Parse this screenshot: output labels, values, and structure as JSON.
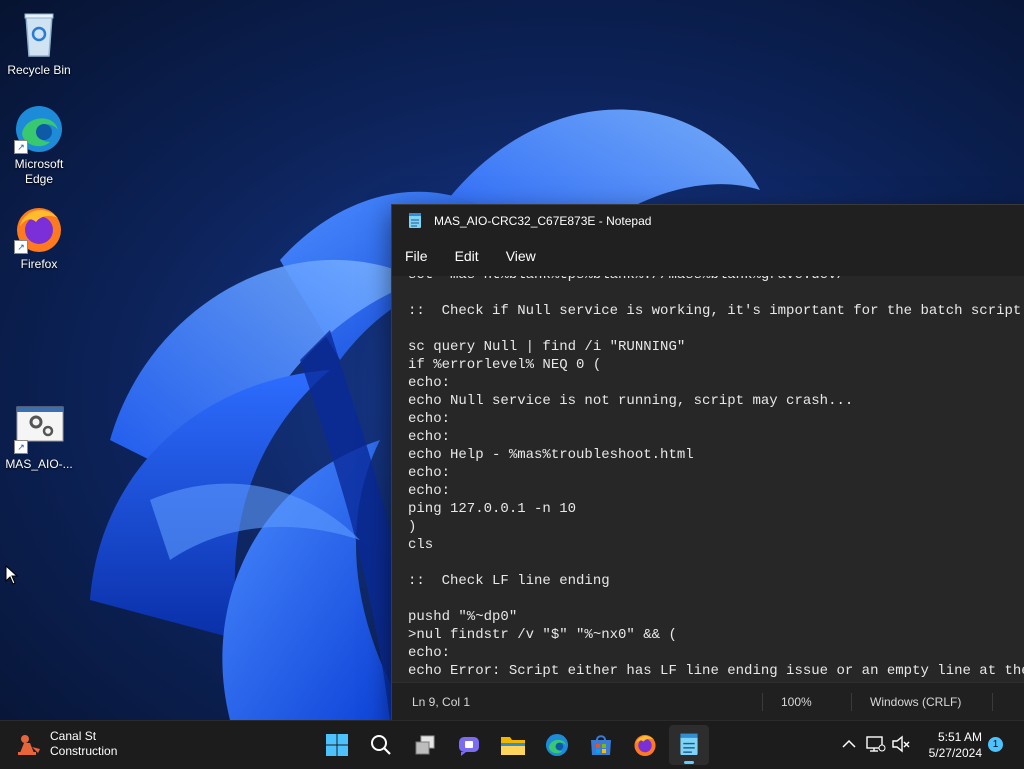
{
  "desktop": {
    "icons": [
      {
        "label": "Recycle Bin",
        "icon": "recycle-bin-icon"
      },
      {
        "label": "Microsoft Edge",
        "icon": "edge-icon"
      },
      {
        "label": "Firefox",
        "icon": "firefox-icon"
      },
      {
        "label": "MAS_AIO-...",
        "icon": "batch-file-icon"
      }
    ]
  },
  "notepad": {
    "title": "MAS_AIO-CRC32_C67E873E - Notepad",
    "menu": [
      "File",
      "Edit",
      "View"
    ],
    "lines": [
      "set \"mas=ht%blank%tps%blank%://mass%blank%grave.dev/",
      "",
      "::  Check if Null service is working, it's important for the batch script",
      "",
      "sc query Null | find /i \"RUNNING\"",
      "if %errorlevel% NEQ 0 (",
      "echo:",
      "echo Null service is not running, script may crash...",
      "echo:",
      "echo:",
      "echo Help - %mas%troubleshoot.html",
      "echo:",
      "echo:",
      "ping 127.0.0.1 -n 10",
      ")",
      "cls",
      "",
      "::  Check LF line ending",
      "",
      "pushd \"%~dp0\"",
      ">nul findstr /v \"$\" \"%~nx0\" && (",
      "echo:",
      "echo Error: Script either has LF line ending issue or an empty line at the en"
    ],
    "status": {
      "position": "Ln 9, Col 1",
      "zoom": "100%",
      "line_ending": "Windows (CRLF)"
    }
  },
  "taskbar": {
    "weather": {
      "line1": "Canal St",
      "line2": "Construction",
      "icon": "traffic-cone-icon"
    },
    "apps": [
      {
        "name": "start",
        "icon": "windows-logo-icon"
      },
      {
        "name": "search",
        "icon": "search-icon"
      },
      {
        "name": "task-view",
        "icon": "task-view-icon"
      },
      {
        "name": "chat",
        "icon": "chat-icon"
      },
      {
        "name": "file-explorer",
        "icon": "folder-icon"
      },
      {
        "name": "edge",
        "icon": "edge-icon"
      },
      {
        "name": "store",
        "icon": "store-icon"
      },
      {
        "name": "firefox",
        "icon": "firefox-icon"
      },
      {
        "name": "notepad",
        "icon": "notepad-icon",
        "active": true
      }
    ],
    "clock": {
      "time": "5:51 AM",
      "date": "5/27/2024"
    },
    "notifications": "1"
  },
  "colors": {
    "accent": "#60cdff",
    "taskbar": "#1c1c1c",
    "notepad_bg": "#272727"
  }
}
